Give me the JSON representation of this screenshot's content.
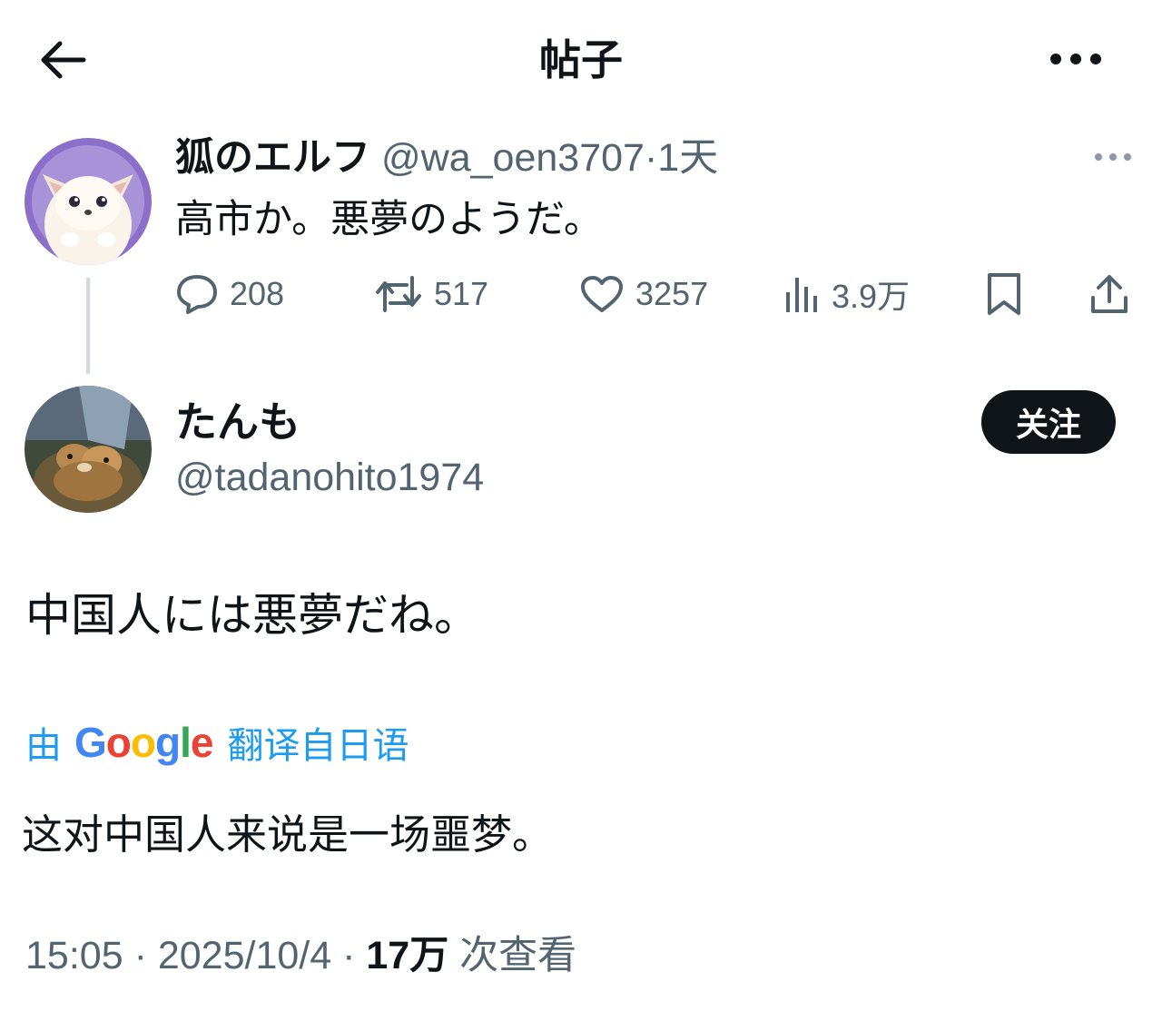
{
  "header": {
    "title": "帖子",
    "back_icon": "arrow-left-icon",
    "more_icon": "more-horizontal-icon"
  },
  "parent_post": {
    "display_name": "狐のエルフ",
    "handle": "@wa_oen3707",
    "separator": "·",
    "time": "1天",
    "text": "高市か。悪夢のようだ。",
    "stats": {
      "replies": "208",
      "reposts": "517",
      "likes": "3257",
      "views": "3.9万"
    }
  },
  "reply_post": {
    "display_name": "たんも",
    "handle": "@tadanohito1974",
    "follow_label": "关注",
    "text": "中国人には悪夢だね。",
    "translate": {
      "prefix": "由",
      "brand": "Google",
      "suffix": "翻译自日语"
    },
    "translated_text": "这对中国人来说是一场噩梦。",
    "meta": {
      "time": "15:05",
      "separator": "·",
      "date": "2025/10/4",
      "view_count": "17万",
      "view_label": "次查看"
    }
  },
  "colors": {
    "text": "#0f1419",
    "secondary": "#536471",
    "link": "#1d9bf0",
    "button_bg": "#0f1419"
  }
}
